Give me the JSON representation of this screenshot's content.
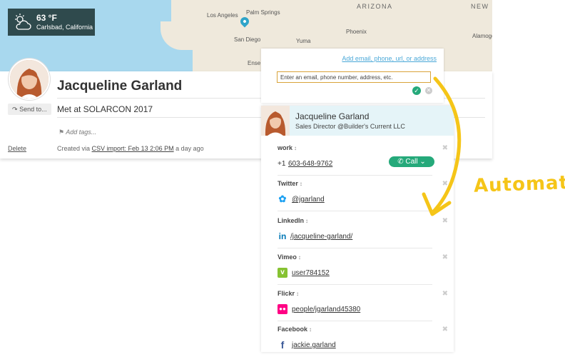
{
  "map": {
    "cities": [
      "Los Angeles",
      "Palm Springs",
      "San Diego",
      "Phoenix",
      "Yuma",
      "Ense"
    ],
    "states": [
      "ARIZONA",
      "NEW MEXIC"
    ],
    "extra": "Alamogor"
  },
  "weather": {
    "temperature": "63 °F",
    "location": "Carlsbad, California",
    "icon": "cloud-sun-icon"
  },
  "contact": {
    "name": "Jacqueline Garland",
    "send_to_label": "Send to...",
    "note": "Met at SOLARCON 2017",
    "tags_placeholder": "Add tags...",
    "delete_label": "Delete",
    "created_prefix": "Created via",
    "created_link": "CSV import: Feb 13 2:06 PM",
    "created_suffix": "a day ago"
  },
  "add_box": {
    "link": "Add email, phone, url, or address",
    "placeholder": "Enter an email, phone number, address, etc."
  },
  "panel": {
    "name": "Jacqueline Garland",
    "role": "Sales Director @Builder's Current LLC",
    "sections": [
      {
        "label": "work",
        "prefix": "+1",
        "value": "603-648-9762",
        "action": "Call"
      },
      {
        "label": "Twitter",
        "value": "@jgarland",
        "icon": "twitter-icon",
        "color": "#1da1f2"
      },
      {
        "label": "LinkedIn",
        "value": "/jacqueline-garland/",
        "icon": "linkedin-icon",
        "color": "#0077b5"
      },
      {
        "label": "Vimeo",
        "value": "user784152",
        "icon": "vimeo-icon",
        "color": "#86c232"
      },
      {
        "label": "Flickr",
        "value": "people/jgarland45380",
        "icon": "flickr-icon",
        "color": "#ff0084"
      },
      {
        "label": "Facebook",
        "value": "jackie.garland",
        "icon": "facebook-icon",
        "color": "#3b5998"
      }
    ]
  },
  "annotation": "Automatic",
  "colors": {
    "accent": "#25a97a",
    "highlight": "#f5c518",
    "link": "#4aa8d8"
  }
}
